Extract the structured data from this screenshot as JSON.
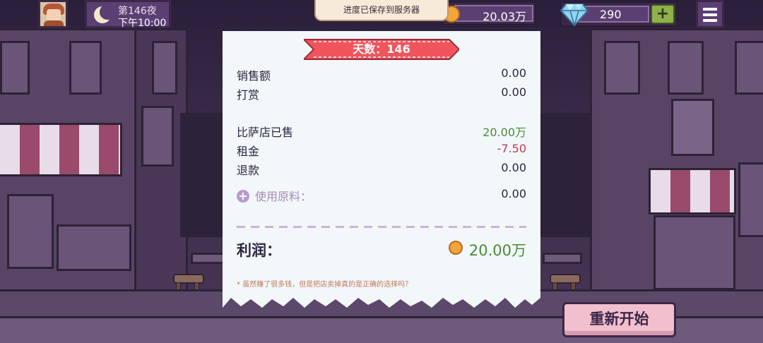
{
  "hud": {
    "day_label": "第146夜",
    "time_label": "下午10:00",
    "toast": "进度已保存到服务器",
    "coins": "20.03万",
    "gems": "290",
    "plus_label": "+"
  },
  "receipt": {
    "banner": "天数：146",
    "rows": [
      {
        "label": "销售额",
        "value": "0.00"
      },
      {
        "label": "打赏",
        "value": "0.00"
      },
      {
        "label": "比萨店已售",
        "value": "20.00万"
      },
      {
        "label": "租金",
        "value": "-7.50"
      },
      {
        "label": "退款",
        "value": "0.00"
      },
      {
        "label": "使用原料：",
        "value": "0.00"
      }
    ],
    "profit_label": "利润：",
    "profit_value": "20.00万",
    "footnote": "* 虽然赚了很多钱，但是把店卖掉真的是正确的选择吗？"
  },
  "restart_label": "重新开始",
  "colors": {
    "positive": "#4e8a36",
    "negative": "#c23a52",
    "banner": "#f0555e",
    "restart": "#f2bfcf"
  },
  "icons": [
    "moon-icon",
    "coin-icon",
    "gem-icon",
    "menu-icon",
    "add-icon"
  ]
}
